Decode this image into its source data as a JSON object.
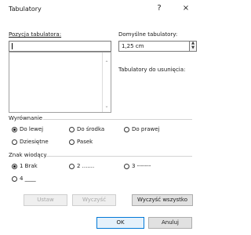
{
  "window": {
    "title": "Tabulatory",
    "help_label": "?",
    "close_label": "×"
  },
  "tab_position": {
    "label": "Pozycja tabulatora:",
    "value": ""
  },
  "default_tabs": {
    "label": "Domyślne tabulatory:",
    "value": "1,25 cm"
  },
  "tabs_to_clear": {
    "label": "Tabulatory do usunięcia:"
  },
  "alignment": {
    "label": "Wyrównanie",
    "options": [
      {
        "label": "Do lewej",
        "checked": true
      },
      {
        "label": "Do środka",
        "checked": false
      },
      {
        "label": "Do prawej",
        "checked": false
      },
      {
        "label": "Dziesiętne",
        "checked": false
      },
      {
        "label": "Pasek",
        "checked": false
      }
    ]
  },
  "leader": {
    "label": "Znak wiodący",
    "options": [
      {
        "label": "1 Brak",
        "checked": true
      },
      {
        "label": "2 .......",
        "checked": false
      },
      {
        "label": "3 -------",
        "checked": false
      },
      {
        "label": "4 ____",
        "checked": false
      }
    ]
  },
  "buttons": {
    "set": "Ustaw",
    "clear": "Wyczyść",
    "clear_all": "Wyczyść wszystko",
    "ok": "OK",
    "cancel": "Anuluj"
  }
}
